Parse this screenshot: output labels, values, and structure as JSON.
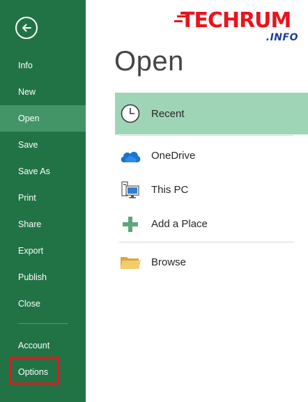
{
  "sidebar": {
    "items": [
      {
        "label": "Info"
      },
      {
        "label": "New"
      },
      {
        "label": "Open"
      },
      {
        "label": "Save"
      },
      {
        "label": "Save As"
      },
      {
        "label": "Print"
      },
      {
        "label": "Share"
      },
      {
        "label": "Export"
      },
      {
        "label": "Publish"
      },
      {
        "label": "Close"
      }
    ],
    "account_label": "Account",
    "options_label": "Options",
    "back_icon": "back-arrow-icon"
  },
  "main": {
    "title": "Open",
    "locations": [
      {
        "label": "Recent",
        "icon": "clock-icon"
      },
      {
        "label": "OneDrive",
        "icon": "cloud-icon"
      },
      {
        "label": "This PC",
        "icon": "computer-icon"
      },
      {
        "label": "Add a Place",
        "icon": "plus-icon"
      },
      {
        "label": "Browse",
        "icon": "folder-icon"
      }
    ]
  },
  "watermark": {
    "text_main": "TECHRUM",
    "text_sub": ".INFO"
  },
  "colors": {
    "sidebar": "#217346",
    "sidebar_active": "#439467",
    "recent_highlight": "#9fd5b7",
    "callout_box": "#e8141d"
  }
}
